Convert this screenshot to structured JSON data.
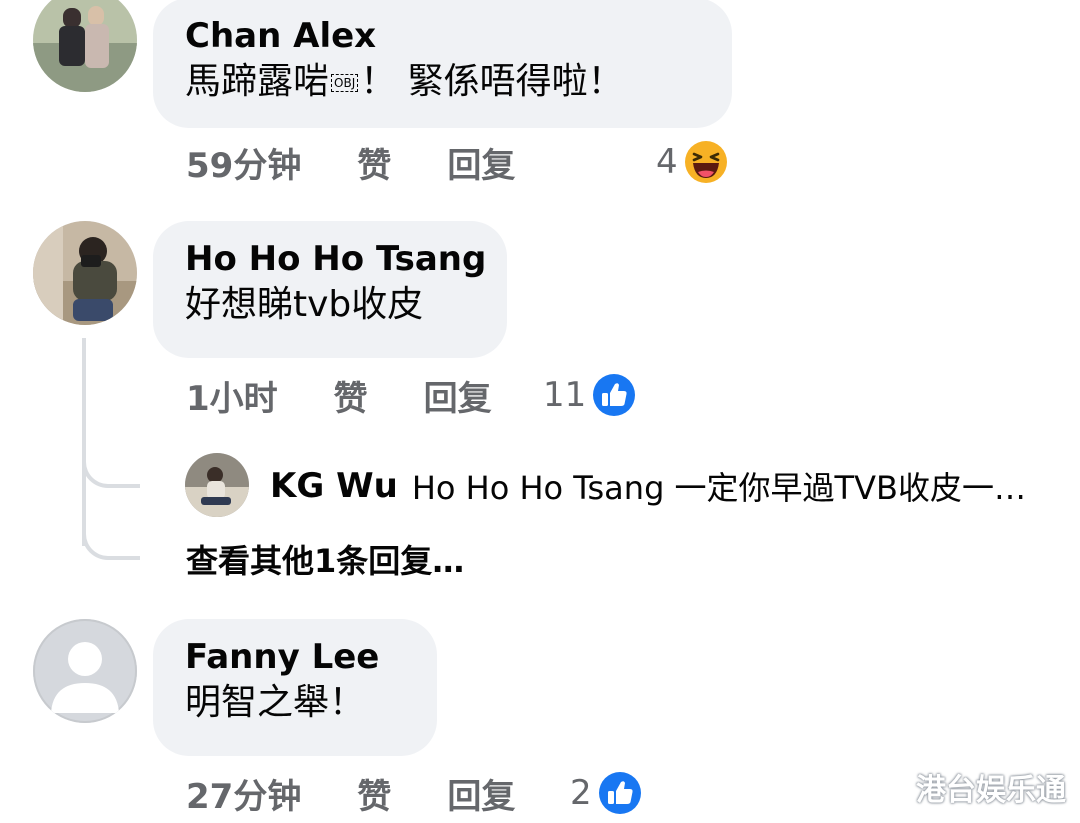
{
  "comments": [
    {
      "author": "Chan Alex",
      "text_main": "馬蹄露啱",
      "text_obj": "OBJ",
      "text_tail": "！ 緊係唔得啦！",
      "time": "59分钟",
      "like_label": "赞",
      "reply_label": "回复",
      "reaction_count": "4",
      "reaction_icon": "haha-emoji-icon"
    },
    {
      "author": "Ho Ho Ho Tsang",
      "text": "好想睇tvb收皮",
      "time": "1小时",
      "like_label": "赞",
      "reply_label": "回复",
      "reaction_count": "11",
      "reaction_icon": "thumbs-up-icon",
      "reply_preview": {
        "author": "KG Wu",
        "text": "Ho Ho Ho Tsang 一定你早過TVB收皮一…"
      },
      "view_more_replies": "查看其他1条回复…"
    },
    {
      "author": "Fanny Lee",
      "text": "明智之舉！",
      "time": "27分钟",
      "like_label": "赞",
      "reply_label": "回复",
      "reaction_count": "2",
      "reaction_icon": "thumbs-up-icon"
    }
  ],
  "watermark": "港台娱乐通",
  "colors": {
    "bubble": "#f0f2f5",
    "meta_text": "#65676b",
    "like_blue": "#1877f2",
    "haha_yellow": "#f7b125"
  }
}
